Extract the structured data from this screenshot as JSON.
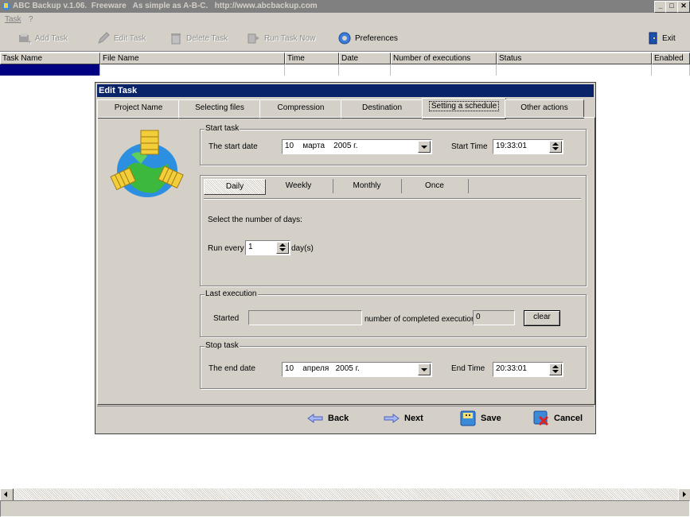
{
  "window": {
    "title": "ABC Backup v.1.06.  Freeware   As simple as A-B-C.   http://www.abcbackup.com",
    "min": "_",
    "max": "□",
    "close": "✕"
  },
  "menu": {
    "task": "Task",
    "help": "?"
  },
  "toolbar": {
    "add_task": "Add Task",
    "edit_task": "Edit Task",
    "delete_task": "Delete Task",
    "run_task_now": "Run Task Now",
    "preferences": "Preferences",
    "exit": "Exit"
  },
  "task_list": {
    "columns": [
      "Task Name",
      "File Name",
      "Time",
      "Date",
      "Number of executions",
      "Status",
      "Enabled"
    ]
  },
  "dialog": {
    "title": "Edit Task",
    "tabs": [
      "Project Name",
      "Selecting files",
      "Compression",
      "Destination",
      "Setting a schedule",
      "Other actions"
    ],
    "active_tab": "Setting a schedule",
    "start_task": {
      "group_label": "Start task",
      "date_label": "The start date",
      "date_value": "10    марта    2005 г.",
      "time_label": "Start Time",
      "time_value": "19:33:01"
    },
    "schedule": {
      "tabs": [
        "Daily",
        "Weekly",
        "Monthly",
        "Once"
      ],
      "active": "Daily",
      "instruction": "Select the number of days:",
      "run_every_label": "Run every",
      "run_every_value": "1",
      "unit": "day(s)"
    },
    "last_execution": {
      "group_label": "Last execution",
      "started_label": "Started",
      "started_value": "",
      "count_label": "number of completed executions",
      "count_value": "0",
      "clear": "clear"
    },
    "stop_task": {
      "group_label": "Stop task",
      "date_label": "The end date",
      "date_value": "10    апреля   2005 г.",
      "time_label": "End Time",
      "time_value": "20:33:01"
    },
    "buttons": {
      "back": "Back",
      "next": "Next",
      "save": "Save",
      "cancel": "Cancel"
    }
  },
  "colors": {
    "title_active": "#0a246a",
    "title_inactive": "#808080",
    "face": "#d4d0c8",
    "selection": "#000080"
  }
}
